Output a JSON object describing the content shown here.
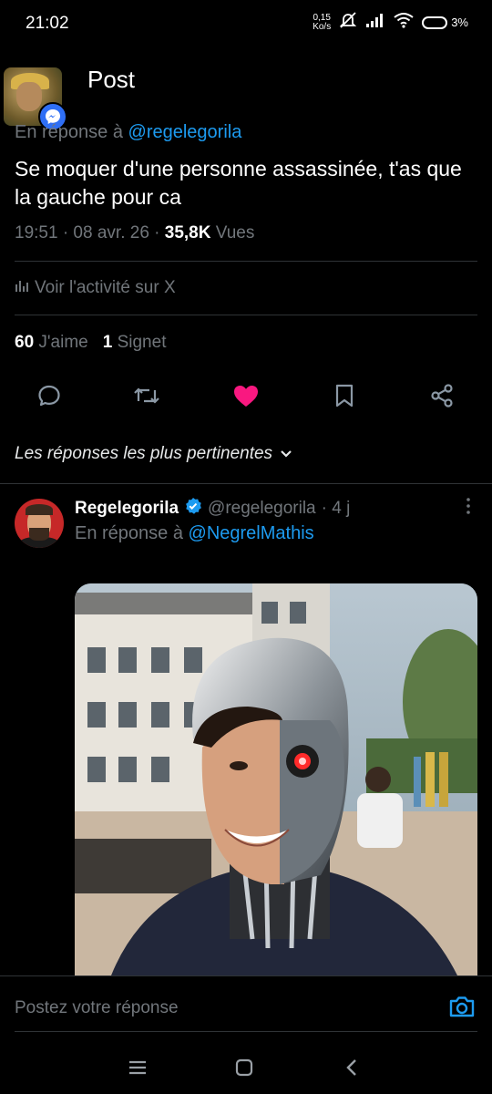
{
  "status_bar": {
    "time": "21:02",
    "net_speed_value": "0,15",
    "net_speed_unit": "Ko/s",
    "battery": "3%"
  },
  "header": {
    "title": "Post"
  },
  "tweet": {
    "reply_prefix": "En réponse à ",
    "reply_handle": "@regelegorila",
    "text": "Se moquer d'une personne assassinée, t'as que la gauche pour ca",
    "meta_time": "19:51 · 08 avr. 26 · ",
    "views_count": "35,8K",
    "views_label": " Vues",
    "activity_label": "Voir l'activité sur X",
    "likes_count": "60",
    "likes_label": "J'aime",
    "bookmarks_count": "1",
    "bookmarks_label": "Signet",
    "liked": true
  },
  "sort_label": "Les réponses les plus pertinentes",
  "reply": {
    "name": "Regelegorila",
    "handle": "@regelegorila",
    "age": "· 4 j",
    "reply_prefix": "En réponse à ",
    "reply_handle": "@NegrelMathis",
    "verified": true
  },
  "composer": {
    "placeholder": "Postez votre réponse"
  },
  "colors": {
    "accent": "#1d9bf0",
    "like": "#f91880",
    "background": "#000000",
    "muted": "#71767b"
  }
}
